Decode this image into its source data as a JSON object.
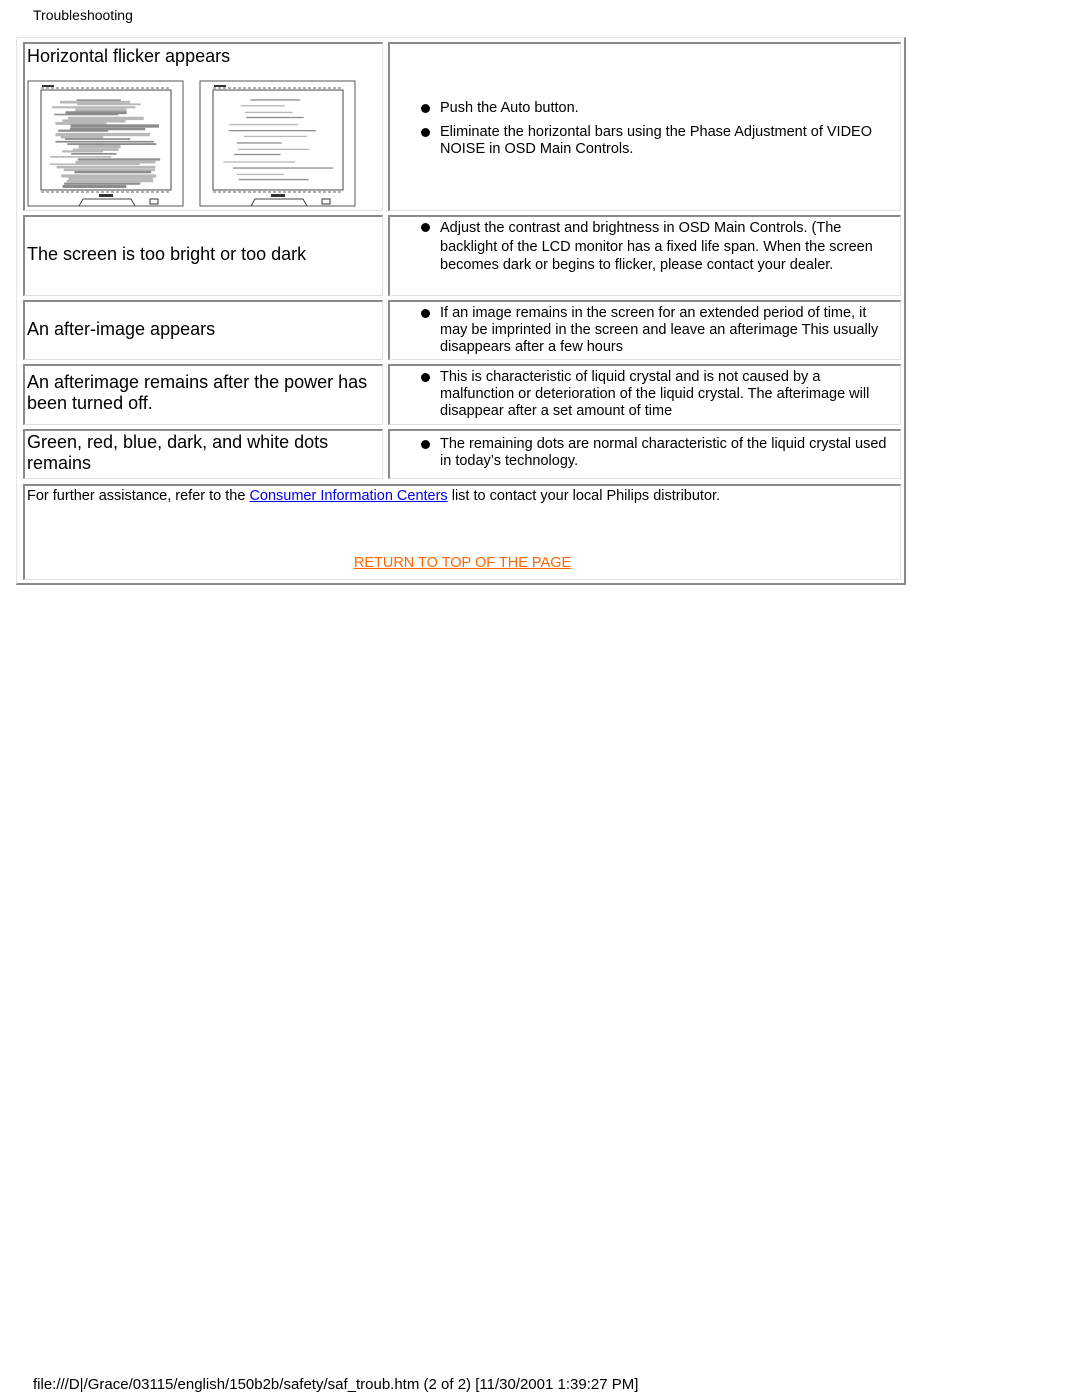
{
  "header": {
    "title": "Troubleshooting"
  },
  "rows": [
    {
      "problem": "Horizontal flicker appears",
      "solutions": [
        "Push the Auto button.",
        "Eliminate the horizontal bars using the Phase Adjustment of VIDEO NOISE in OSD Main Controls."
      ],
      "images": [
        "monitor-with-heavy-horizontal-flicker",
        "monitor-with-light-horizontal-lines"
      ]
    },
    {
      "problem": "The screen is too bright or too dark",
      "solutions": [
        "Adjust the contrast and brightness in OSD Main Controls. (The backlight of the LCD monitor has a fixed life span. When the screen becomes dark or begins to flicker, please contact your dealer."
      ]
    },
    {
      "problem": "An after-image appears",
      "solutions": [
        "If an image remains in the screen for an extended period of time, it may be imprinted in the screen and leave an afterimage This usually disappears after a few hours"
      ]
    },
    {
      "problem": "An afterimage remains after the power has been turned off.",
      "solutions": [
        "This is characteristic of liquid crystal and is not caused by a malfunction or deterioration of the liquid crystal. The afterimage will disappear after a set amount of time"
      ]
    },
    {
      "problem": "Green, red, blue, dark, and white dots remains",
      "solutions": [
        "The remaining dots are normal characteristic of the liquid crystal used in today’s technology."
      ]
    }
  ],
  "footer_note": {
    "prefix": "For further assistance, refer to the ",
    "link_text": "Consumer Information Centers",
    "suffix": " list to contact your local Philips distributor."
  },
  "return_link": "RETURN TO TOP OF THE PAGE",
  "colors": {
    "link": "#0000ee",
    "return_link": "#ff6600",
    "border_dark": "#8a8a8a",
    "border_light": "#e0e0e0"
  },
  "file_footer": "file:///D|/Grace/03115/english/150b2b/safety/saf_troub.htm (2 of 2) [11/30/2001 1:39:27 PM]"
}
